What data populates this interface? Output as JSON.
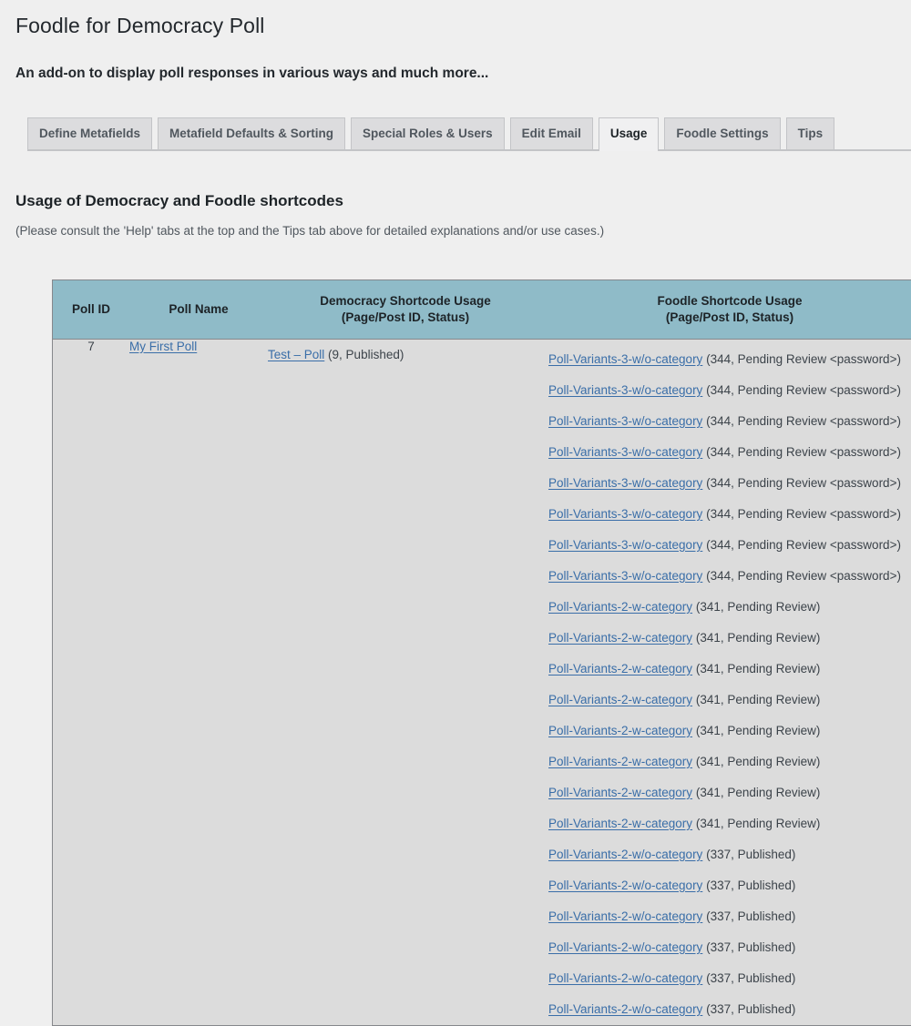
{
  "page": {
    "title": "Foodle for Democracy Poll",
    "subtitle": "An add-on to display poll responses in various ways and much more..."
  },
  "tabs": [
    {
      "label": "Define Metafields",
      "active": false
    },
    {
      "label": "Metafield Defaults & Sorting",
      "active": false
    },
    {
      "label": "Special Roles & Users",
      "active": false
    },
    {
      "label": "Edit Email",
      "active": false
    },
    {
      "label": "Usage",
      "active": true
    },
    {
      "label": "Foodle Settings",
      "active": false
    },
    {
      "label": "Tips",
      "active": false
    }
  ],
  "section": {
    "heading": "Usage of Democracy and Foodle shortcodes",
    "note": "(Please consult the 'Help' tabs at the top and the Tips tab above for detailed explanations and/or use cases.)"
  },
  "table": {
    "headers": {
      "poll_id": "Poll ID",
      "poll_name": "Poll Name",
      "democracy_line1": "Democracy Shortcode Usage",
      "democracy_line2": "(Page/Post ID, Status)",
      "foodle_line1": "Foodle Shortcode Usage",
      "foodle_line2": "(Page/Post ID, Status)"
    },
    "row": {
      "poll_id": "7",
      "poll_name_link": "My First Poll",
      "democracy_link": "Test – Poll",
      "democracy_meta": "(9, Published)"
    },
    "foodle_entries": [
      {
        "link": "Poll-Variants-3-w/o-category",
        "meta": "(344, Pending Review <password>)"
      },
      {
        "link": "Poll-Variants-3-w/o-category",
        "meta": "(344, Pending Review <password>)"
      },
      {
        "link": "Poll-Variants-3-w/o-category",
        "meta": "(344, Pending Review <password>)"
      },
      {
        "link": "Poll-Variants-3-w/o-category",
        "meta": "(344, Pending Review <password>)"
      },
      {
        "link": "Poll-Variants-3-w/o-category",
        "meta": "(344, Pending Review <password>)"
      },
      {
        "link": "Poll-Variants-3-w/o-category",
        "meta": "(344, Pending Review <password>)"
      },
      {
        "link": "Poll-Variants-3-w/o-category",
        "meta": "(344, Pending Review <password>)"
      },
      {
        "link": "Poll-Variants-3-w/o-category",
        "meta": "(344, Pending Review <password>)"
      },
      {
        "link": "Poll-Variants-2-w-category",
        "meta": "(341, Pending Review)"
      },
      {
        "link": "Poll-Variants-2-w-category",
        "meta": "(341, Pending Review)"
      },
      {
        "link": "Poll-Variants-2-w-category",
        "meta": "(341, Pending Review)"
      },
      {
        "link": "Poll-Variants-2-w-category",
        "meta": "(341, Pending Review)"
      },
      {
        "link": "Poll-Variants-2-w-category",
        "meta": "(341, Pending Review)"
      },
      {
        "link": "Poll-Variants-2-w-category",
        "meta": "(341, Pending Review)"
      },
      {
        "link": "Poll-Variants-2-w-category",
        "meta": "(341, Pending Review)"
      },
      {
        "link": "Poll-Variants-2-w-category",
        "meta": "(341, Pending Review)"
      },
      {
        "link": "Poll-Variants-2-w/o-category",
        "meta": "(337, Published)"
      },
      {
        "link": "Poll-Variants-2-w/o-category",
        "meta": "(337, Published)"
      },
      {
        "link": "Poll-Variants-2-w/o-category",
        "meta": "(337, Published)"
      },
      {
        "link": "Poll-Variants-2-w/o-category",
        "meta": "(337, Published)"
      },
      {
        "link": "Poll-Variants-2-w/o-category",
        "meta": "(337, Published)"
      },
      {
        "link": "Poll-Variants-2-w/o-category",
        "meta": "(337, Published)"
      }
    ]
  },
  "colors": {
    "page_background": "#efefef",
    "table_header": "#8fbbc8",
    "table_body": "#dcdcdc",
    "link": "#3a6ea8",
    "tab_inactive": "#dcdcde",
    "tab_active": "#f0f0f1"
  }
}
